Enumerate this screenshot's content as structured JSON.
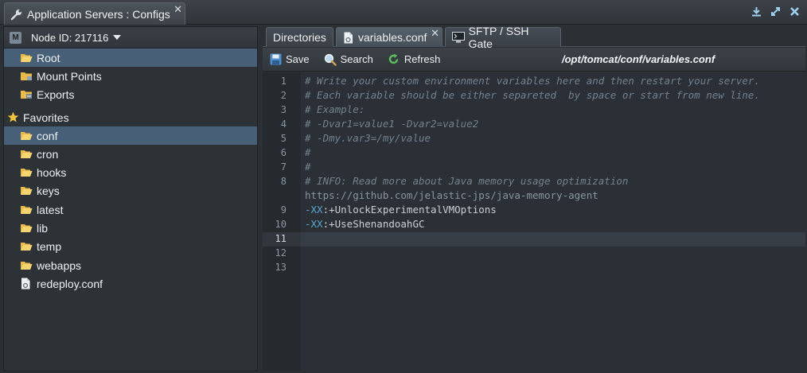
{
  "window": {
    "title": "Application Servers : Configs"
  },
  "node": {
    "label": "Node ID: 217116"
  },
  "tree": {
    "items": [
      {
        "label": "Root",
        "selected": true
      },
      {
        "label": "Mount Points",
        "selected": false
      },
      {
        "label": "Exports",
        "selected": false
      }
    ],
    "favorites_label": "Favorites",
    "favorites": [
      {
        "label": "conf",
        "selected": true
      },
      {
        "label": "cron",
        "selected": false
      },
      {
        "label": "hooks",
        "selected": false
      },
      {
        "label": "keys",
        "selected": false
      },
      {
        "label": "latest",
        "selected": false
      },
      {
        "label": "lib",
        "selected": false
      },
      {
        "label": "temp",
        "selected": false
      },
      {
        "label": "webapps",
        "selected": false
      },
      {
        "label": "redeploy.conf",
        "selected": false
      }
    ]
  },
  "tabs": [
    {
      "label": "Directories",
      "active": false
    },
    {
      "label": "variables.conf",
      "active": true
    },
    {
      "label": "SFTP / SSH Gate",
      "active": false
    }
  ],
  "toolbar": {
    "save_label": "Save",
    "search_label": "Search",
    "refresh_label": "Refresh",
    "file_path": "/opt/tomcat/conf/variables.conf"
  },
  "editor": {
    "current_line": 11,
    "lines": [
      {
        "num": "1",
        "text": "# Write your custom environment variables here and then restart your server."
      },
      {
        "num": "2",
        "text": "# Each variable should be either separeted  by space or start from new line."
      },
      {
        "num": "3",
        "text": "# Example:"
      },
      {
        "num": "4",
        "text": "# -Dvar1=value1 -Dvar2=value2"
      },
      {
        "num": "5",
        "text": "# -Dmy.var3=/my/value"
      },
      {
        "num": "6",
        "text": "#"
      },
      {
        "num": "7",
        "text": "#"
      },
      {
        "num": "8",
        "text": "# INFO: Read more about Java memory usage optimization"
      },
      {
        "num": "",
        "text": "https://github.com/jelastic-jps/java-memory-agent"
      },
      {
        "num": "9",
        "opt": "-XX",
        "val": ":+UnlockExperimentalVMOptions"
      },
      {
        "num": "10",
        "opt": "-XX",
        "val": ":+UseShenandoahGC"
      },
      {
        "num": "11",
        "text": ""
      },
      {
        "num": "12",
        "text": ""
      },
      {
        "num": "13",
        "text": ""
      }
    ]
  },
  "colors": {
    "selection": "#476078",
    "background": "#2b3035",
    "option_blue": "#56a8cf"
  }
}
